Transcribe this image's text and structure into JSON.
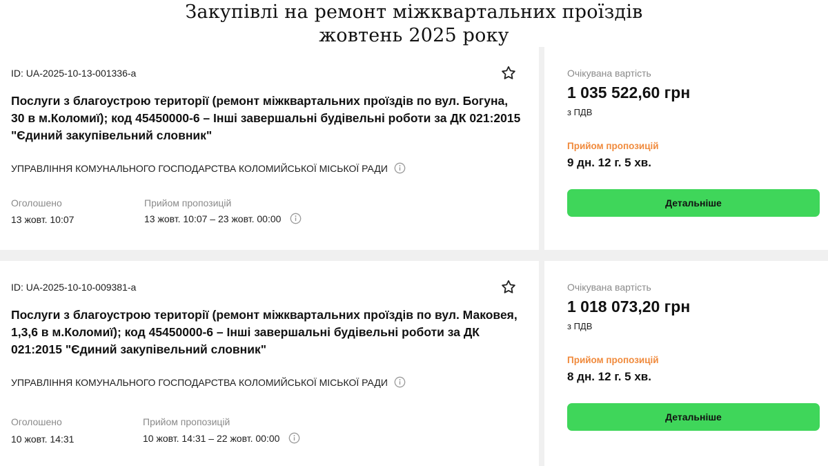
{
  "headline": {
    "line1": "Закупівлі на ремонт міжквартальних проїздів",
    "line2": "жовтень 2025 року"
  },
  "labels": {
    "expected_value": "Очікувана вартість",
    "vat": "з ПДВ",
    "receiving": "Прийом пропозицій",
    "announced": "Оголошено",
    "details_button": "Детальніше"
  },
  "tenders": [
    {
      "id": "ID: UA-2025-10-13-001336-a",
      "title": "Послуги з благоустрою території (ремонт міжквартальних проїздів по вул. Богуна, 30 в м.Коломиї); код 45450000-6 – Інші завершальні будівельні роботи за ДК 021:2015 \"Єдиний закупівельний словник\"",
      "organization": "УПРАВЛІННЯ КОМУНАЛЬНОГО ГОСПОДАРСТВА КОЛОМИЙСЬКОЇ МІСЬКОЇ РАДИ",
      "announced": "13 жовт. 10:07",
      "receiving_period": "13 жовт. 10:07 – 23 жовт. 00:00",
      "amount": "1 035 522,60 грн",
      "remaining": "9 дн. 12 г. 5 хв."
    },
    {
      "id": "ID: UA-2025-10-10-009381-a",
      "title": "Послуги з благоустрою території (ремонт міжквартальних проїздів по вул. Маковея, 1,3,6 в м.Коломиї); код 45450000-6 – Інші завершальні будівельні роботи за ДК 021:2015 \"Єдиний закупівельний словник\"",
      "organization": "УПРАВЛІННЯ КОМУНАЛЬНОГО ГОСПОДАРСТВА КОЛОМИЙСЬКОЇ МІСЬКОЇ РАДИ",
      "announced": "10 жовт. 14:31",
      "receiving_period": "10 жовт. 14:31 – 22 жовт. 00:00",
      "amount": "1 018 073,20 грн",
      "remaining": "8 дн. 12 г. 5 хв."
    }
  ],
  "icons": {
    "favorite": "star-outline-icon",
    "info": "info-circle-icon"
  },
  "colors": {
    "accent_button": "#3fd65a",
    "receiving_label": "#f08a3c",
    "muted_text": "#8a8a8a",
    "separator": "#f0f0f0"
  }
}
